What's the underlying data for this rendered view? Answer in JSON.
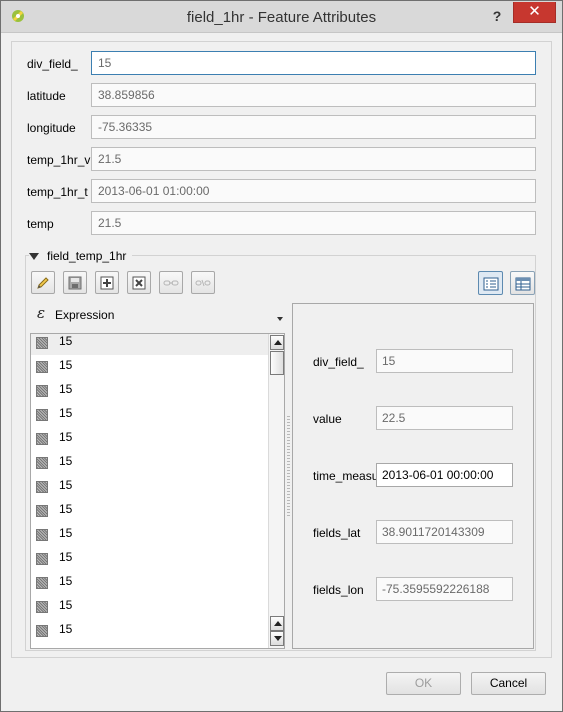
{
  "window": {
    "title": "field_1hr - Feature Attributes",
    "help_glyph": "?",
    "close_glyph": "✕"
  },
  "fields": [
    {
      "label": "div_field_",
      "value": "15"
    },
    {
      "label": "latitude",
      "value": "38.859856"
    },
    {
      "label": "longitude",
      "value": "-75.36335"
    },
    {
      "label": "temp_1hr_v",
      "value": "21.5"
    },
    {
      "label": "temp_1hr_t",
      "value": "2013-06-01 01:00:00"
    },
    {
      "label": "temp",
      "value": "21.5"
    }
  ],
  "relation": {
    "title": "field_temp_1hr",
    "toolbar": [
      "pencil-icon",
      "save-icon",
      "add-icon",
      "delete-icon",
      "link-icon",
      "unlink-icon"
    ],
    "view_buttons": [
      "form-view-icon",
      "table-view-icon"
    ],
    "expression": {
      "symbol": "ε",
      "label": "Expression"
    },
    "list_items": [
      "15",
      "15",
      "15",
      "15",
      "15",
      "15",
      "15",
      "15",
      "15",
      "15",
      "15",
      "15",
      "15"
    ],
    "form": [
      {
        "label": "div_field_",
        "value": "15"
      },
      {
        "label": "value",
        "value": "22.5"
      },
      {
        "label": "time_measu",
        "value": "2013-06-01 00:00:00"
      },
      {
        "label": "fields_lat",
        "value": "38.9011720143309"
      },
      {
        "label": "fields_lon",
        "value": "-75.3595592226188"
      }
    ]
  },
  "buttons": {
    "ok": "OK",
    "cancel": "Cancel"
  }
}
